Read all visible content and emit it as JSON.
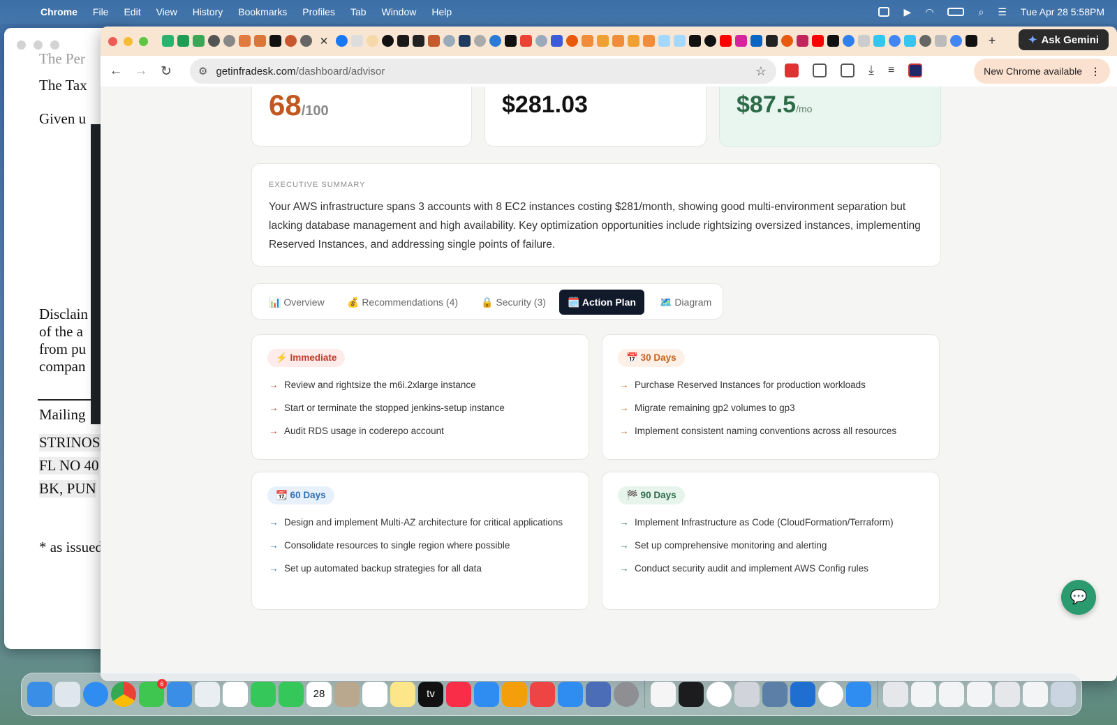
{
  "menubar": {
    "app_name": "Chrome",
    "menus": [
      "File",
      "Edit",
      "View",
      "History",
      "Bookmarks",
      "Profiles",
      "Tab",
      "Window",
      "Help"
    ],
    "datetime": "Tue Apr 28  5:58PM"
  },
  "back_window": {
    "lines": [
      "The Per",
      "The Tax",
      "Given u",
      "Disclain",
      "of the a",
      "from pu",
      "compan",
      "Mailing",
      "STRINOS",
      "FL NO 40",
      "BK, PUN",
      "* as issued"
    ]
  },
  "browser": {
    "ask_gemini_label": "Ask Gemini",
    "url_host": "getinfradesk.com",
    "url_path": "/dashboard/advisor",
    "new_chrome_label": "New Chrome available"
  },
  "stats": [
    {
      "value": "68",
      "unit": "/100",
      "accent": "#c2571f"
    },
    {
      "value": "$281.03",
      "unit": "",
      "accent": "#111111"
    },
    {
      "value": "$87.5",
      "unit": "/mo",
      "accent": "#2d6b48"
    }
  ],
  "summary": {
    "label": "EXECUTIVE SUMMARY",
    "text": "Your AWS infrastructure spans 3 accounts with 8 EC2 instances costing $281/month, showing good multi-environment separation but lacking database management and high availability. Key optimization opportunities include rightsizing oversized instances, implementing Reserved Instances, and addressing single points of failure."
  },
  "tabs": [
    {
      "label": "📊 Overview",
      "active": false
    },
    {
      "label": "💰 Recommendations (4)",
      "active": false
    },
    {
      "label": "🔒 Security (3)",
      "active": false
    },
    {
      "label": "🗓️ Action Plan",
      "active": true
    },
    {
      "label": "🗺️ Diagram",
      "active": false
    }
  ],
  "plan": [
    {
      "badge": "⚡ Immediate",
      "color": "#c0392b",
      "items": [
        "Review and rightsize the m6i.2xlarge instance",
        "Start or terminate the stopped jenkins-setup instance",
        "Audit RDS usage in coderepo account"
      ]
    },
    {
      "badge": "📅 30 Days",
      "color": "#c4621f",
      "items": [
        "Purchase Reserved Instances for production workloads",
        "Migrate remaining gp2 volumes to gp3",
        "Implement consistent naming conventions across all resources"
      ]
    },
    {
      "badge": "📆 60 Days",
      "color": "#2f6fb5",
      "items": [
        "Design and implement Multi-AZ architecture for critical applications",
        "Consolidate resources to single region where possible",
        "Set up automated backup strategies for all data"
      ]
    },
    {
      "badge": "🏁 90 Days",
      "color": "#2d6b48",
      "items": [
        "Implement Infrastructure as Code (CloudFormation/Terraform)",
        "Set up comprehensive monitoring and alerting",
        "Conduct security audit and implement AWS Config rules"
      ]
    }
  ],
  "dock": {
    "calendar_day": "28",
    "messages_badge": "6",
    "tv_label": "tv"
  }
}
